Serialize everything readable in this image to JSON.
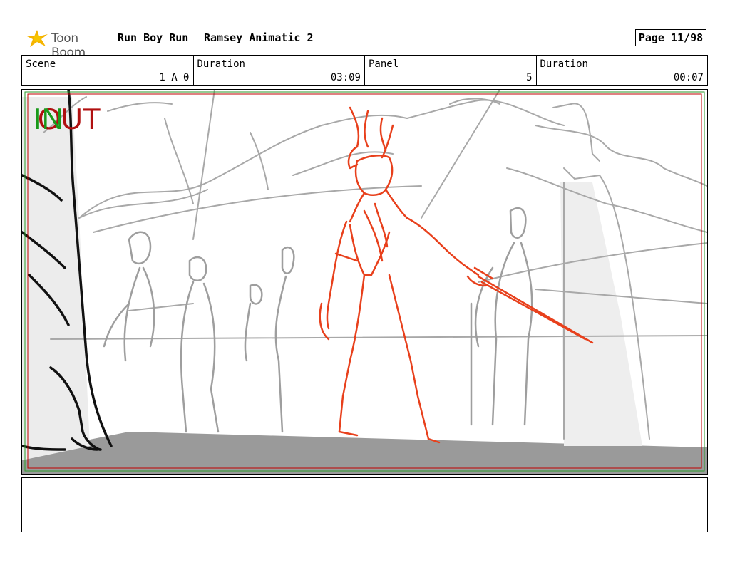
{
  "header": {
    "logo_text": "Toon Boom",
    "project": "Run Boy Run",
    "sequence": "Ramsey Animatic 2",
    "page": "Page 11/98"
  },
  "info": {
    "scene_label": "Scene",
    "scene_value": "1_A_0",
    "duration1_label": "Duration",
    "duration1_value": "03:09",
    "panel_label": "Panel",
    "panel_value": "5",
    "duration2_label": "Duration",
    "duration2_value": "00:07"
  },
  "panel": {
    "in_marker": "IN",
    "out_marker": "OUT"
  },
  "colors": {
    "sketch_red": "#e8401c",
    "sketch_gray": "#a8a8a8",
    "floor_gray": "#999999",
    "frame_red": "#c00000",
    "frame_green": "#2a9a2a"
  },
  "notes": {
    "text": ""
  }
}
